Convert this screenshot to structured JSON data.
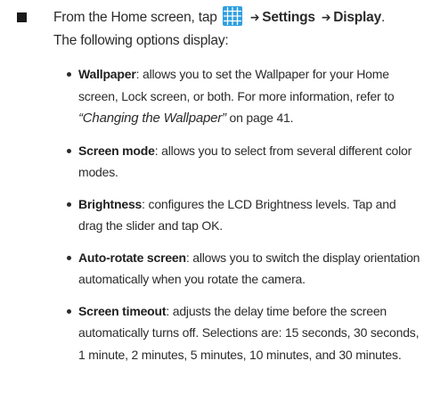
{
  "step": {
    "prefix": "From the Home screen, tap",
    "apps_icon": "apps-grid-icon",
    "arrow_1": "➔",
    "settings": "Settings",
    "arrow_2": "➔",
    "display": "Display",
    "end": ".",
    "subline": "The following options display:"
  },
  "colors": {
    "apps_icon_fill": "#2e9fe0",
    "apps_icon_grid": "#ffffff",
    "text": "#2b2b2b"
  },
  "options": [
    {
      "term": "Wallpaper",
      "colon": ":",
      "text": " allows you to set the Wallpaper for your Home screen, Lock screen, or both. For more information, refer to ",
      "xref": "“Changing the Wallpaper”",
      "after": " on page 41."
    },
    {
      "term": "Screen mode",
      "colon": ":",
      "text": " allows you to select from several different color modes."
    },
    {
      "term": "Brightness",
      "colon": ":",
      "text": " configures the LCD Brightness levels. Tap and drag the slider and tap OK."
    },
    {
      "term": "Auto-rotate screen",
      "colon": ":",
      "text": " allows you to switch the display orientation automatically when you rotate the camera."
    },
    {
      "term": "Screen timeout",
      "colon": ":",
      "text": " adjusts the delay time before the screen automatically turns off. Selections are: 15 seconds, 30 seconds, 1 minute, 2 minutes, 5 minutes, 10 minutes, and 30 minutes."
    }
  ]
}
